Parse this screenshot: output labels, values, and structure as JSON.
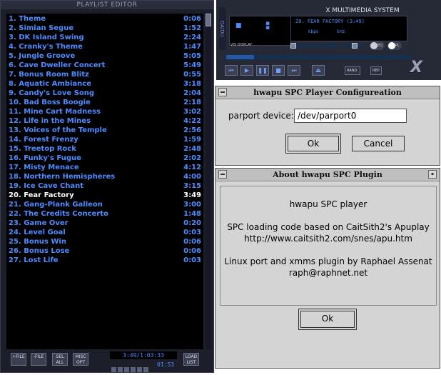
{
  "playlist": {
    "title": "PLAYLIST EDITOR",
    "current_index": 19,
    "items": [
      {
        "title": "1. Theme",
        "duration": "0:06"
      },
      {
        "title": "2. Simian Segue",
        "duration": "1:52"
      },
      {
        "title": "3. DK Island Swing",
        "duration": "2:24"
      },
      {
        "title": "4. Cranky's Theme",
        "duration": "1:47"
      },
      {
        "title": "5. Jungle Groove",
        "duration": "5:05"
      },
      {
        "title": "6. Cave Dweller Concert",
        "duration": "5:49"
      },
      {
        "title": "7. Bonus Room Blitz",
        "duration": "0:55"
      },
      {
        "title": "8. Aquatic Ambiance",
        "duration": "3:18"
      },
      {
        "title": "9. Candy's Love Song",
        "duration": "2:04"
      },
      {
        "title": "10. Bad Boss Boogie",
        "duration": "2:18"
      },
      {
        "title": "11. Mine Cart Madness",
        "duration": "3:02"
      },
      {
        "title": "12. Life in the Mines",
        "duration": "4:22"
      },
      {
        "title": "13. Voices of the Temple",
        "duration": "2:56"
      },
      {
        "title": "14. Forest Frenzy",
        "duration": "1:59"
      },
      {
        "title": "15. Treetop Rock",
        "duration": "2:48"
      },
      {
        "title": "16. Funky's Fugue",
        "duration": "2:02"
      },
      {
        "title": "17. Misty Menace",
        "duration": "4:12"
      },
      {
        "title": "18. Northern Hemispheres",
        "duration": "4:00"
      },
      {
        "title": "19. Ice Cave Chant",
        "duration": "3:15"
      },
      {
        "title": "20. Fear Factory",
        "duration": "3:49"
      },
      {
        "title": "21. Gang-Plank Galleon",
        "duration": "3:00"
      },
      {
        "title": "22. The Credits Concerto",
        "duration": "1:48"
      },
      {
        "title": "23. Game Over",
        "duration": "0:20"
      },
      {
        "title": "24. Level Goal",
        "duration": "0:03"
      },
      {
        "title": "25. Bonus Win",
        "duration": "0:06"
      },
      {
        "title": "26. Bonus Lose",
        "duration": "0:06"
      },
      {
        "title": "27. Lost Life",
        "duration": "0:03"
      }
    ],
    "buttons": [
      {
        "label": "+FILE",
        "icon": "add-file-icon"
      },
      {
        "label": "-FILE",
        "icon": "remove-file-icon"
      },
      {
        "label": "SEL ALL",
        "icon": "select-all-icon"
      },
      {
        "label": "MISC OPT",
        "icon": "misc-options-icon"
      }
    ],
    "load_list_label": "LOAD LIST",
    "time_display": "3:49/1:03:33",
    "mini_time": "01:53"
  },
  "player": {
    "title": "X MULTIMEDIA SYSTEM",
    "vertical_title": "OAIDU",
    "lcd_label": "VIS DISPLAY",
    "song_display": "20. FEAR FACTORY (3:49)",
    "kbps_label": "kbps",
    "khz_label": "kHz",
    "eq_label": "EQ",
    "pl_label": "PL",
    "rand_label": "RAND.",
    "rep_label": "REP.",
    "seek_progress": 0.15,
    "transport_icons": [
      "previous-icon",
      "play-icon",
      "pause-icon",
      "stop-icon",
      "next-icon",
      "eject-icon"
    ],
    "colors": {
      "lcd_text": "#4c8cff",
      "background": "#262a36"
    }
  },
  "config": {
    "title": "hwapu SPC Player Configureation",
    "field_label": "parport device:",
    "field_value": "/dev/parport0",
    "ok_label": "Ok",
    "cancel_label": "Cancel"
  },
  "about": {
    "title": "About hwapu SPC Plugin",
    "lines": [
      "hwapu SPC player",
      "SPC loading code based on CaitSith2's Apuplay",
      "http://www.caitsith2.com/snes/apu.htm",
      "Linux port and xmms plugin by Raphael Assenat",
      "raph@raphnet.net"
    ],
    "ok_label": "Ok"
  }
}
